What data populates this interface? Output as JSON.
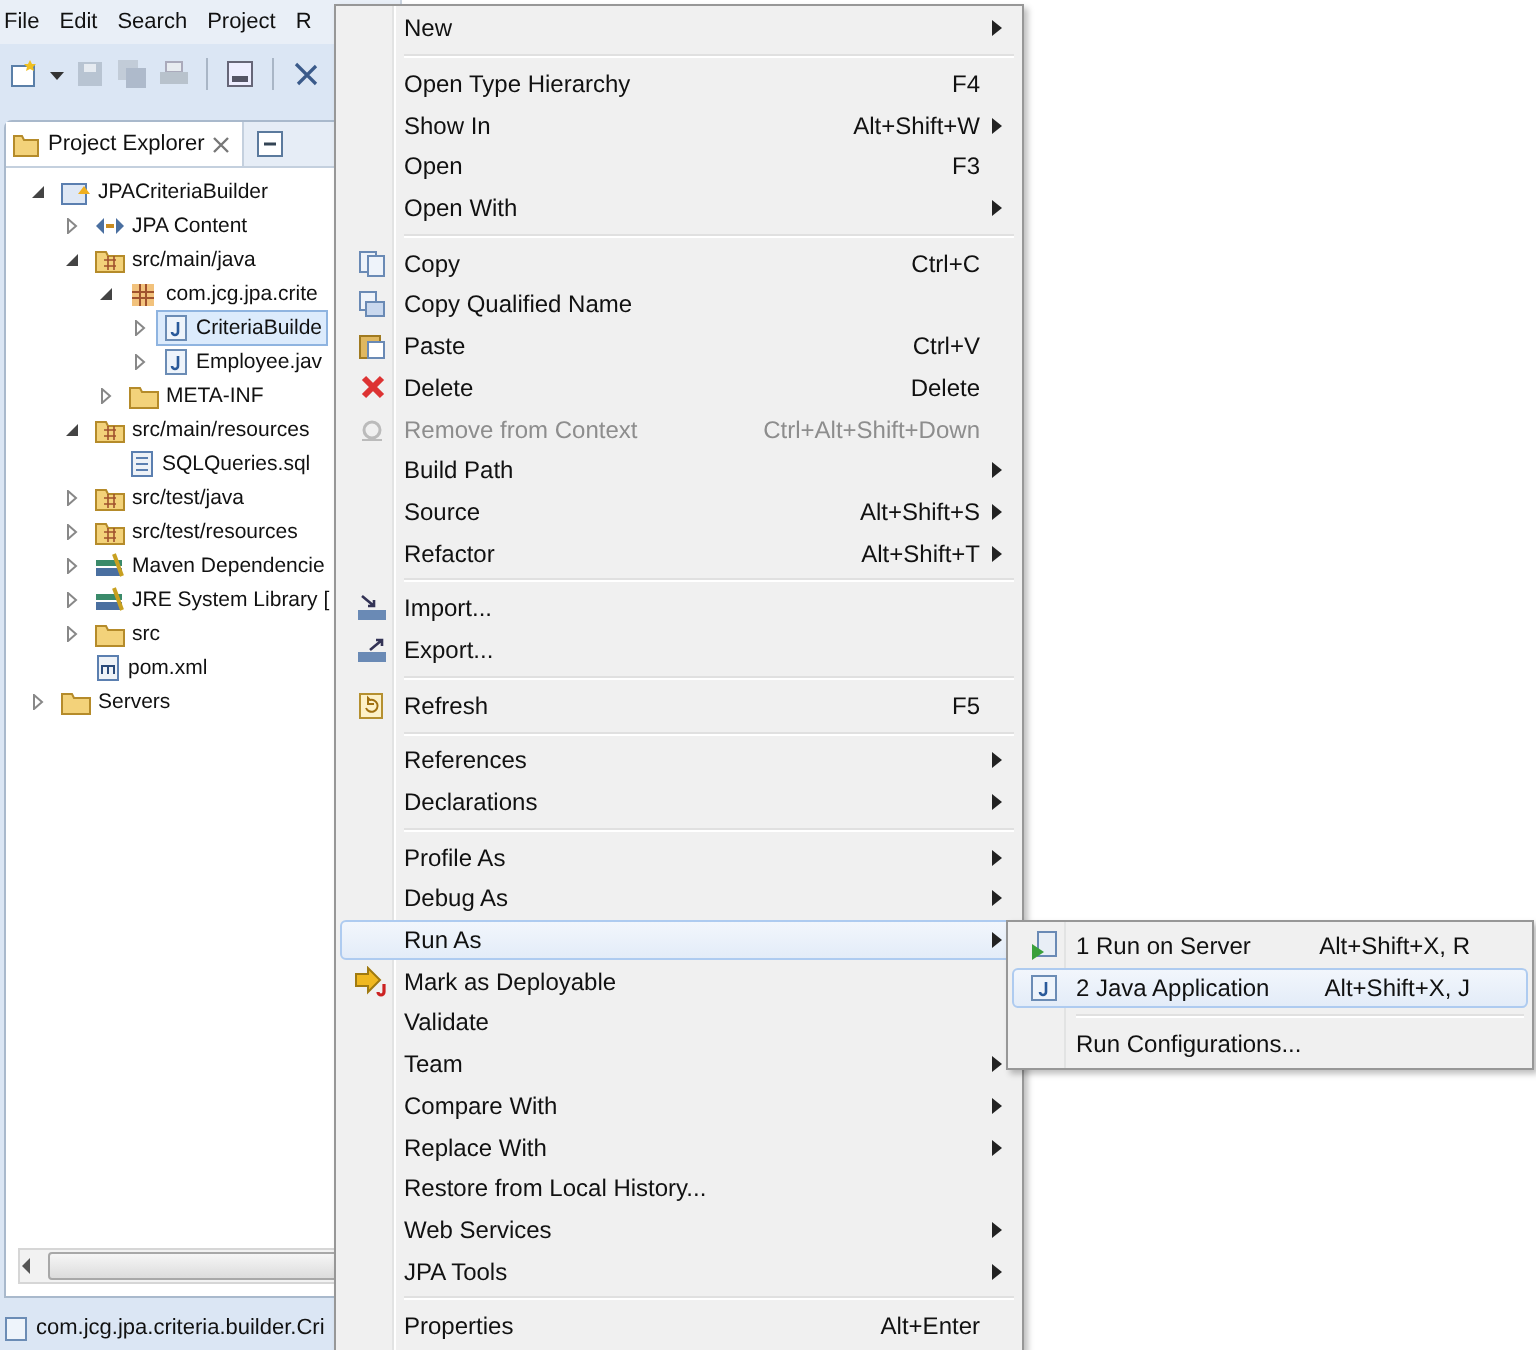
{
  "menubar": [
    "File",
    "Edit",
    "Search",
    "Project",
    "R"
  ],
  "explorer": {
    "title": "Project Explorer",
    "tree": [
      {
        "label": "JPACriteriaBuilder",
        "kind": "project",
        "expanded": true,
        "selected": false,
        "children": [
          {
            "label": "JPA Content",
            "kind": "jpa",
            "expanded": false,
            "selected": false
          },
          {
            "label": "src/main/java",
            "kind": "source-folder",
            "expanded": true,
            "selected": false,
            "children": [
              {
                "label": "com.jcg.jpa.crite",
                "kind": "package",
                "expanded": true,
                "selected": false,
                "children": [
                  {
                    "label": "CriteriaBuilde",
                    "kind": "java",
                    "expanded": false,
                    "selected": true
                  },
                  {
                    "label": "Employee.jav",
                    "kind": "java",
                    "expanded": false,
                    "selected": false
                  }
                ]
              },
              {
                "label": "META-INF",
                "kind": "folder",
                "expanded": false,
                "selected": false
              }
            ]
          },
          {
            "label": "src/main/resources",
            "kind": "source-folder",
            "expanded": true,
            "selected": false,
            "children": [
              {
                "label": "SQLQueries.sql",
                "kind": "sql",
                "selected": false
              }
            ]
          },
          {
            "label": "src/test/java",
            "kind": "source-folder",
            "expanded": false,
            "selected": false
          },
          {
            "label": "src/test/resources",
            "kind": "source-folder",
            "expanded": false,
            "selected": false
          },
          {
            "label": "Maven Dependencie",
            "kind": "library",
            "expanded": false,
            "selected": false
          },
          {
            "label": "JRE System Library [",
            "kind": "library",
            "expanded": false,
            "selected": false
          },
          {
            "label": "src",
            "kind": "folder",
            "expanded": false,
            "selected": false
          },
          {
            "label": "pom.xml",
            "kind": "xml",
            "selected": false
          }
        ]
      },
      {
        "label": "Servers",
        "kind": "folder",
        "expanded": false,
        "selected": false
      }
    ]
  },
  "status_bar": {
    "text": "com.jcg.jpa.criteria.builder.Cri"
  },
  "context_menu": [
    {
      "kind": "item",
      "label": "New",
      "submenu": true,
      "disabled": false,
      "selected": false
    },
    {
      "kind": "separator"
    },
    {
      "kind": "item",
      "label": "Open Type Hierarchy",
      "shortcut": "F4",
      "submenu": false,
      "disabled": false,
      "selected": false
    },
    {
      "kind": "item",
      "label": "Show In",
      "shortcut": "Alt+Shift+W",
      "submenu": true,
      "disabled": false,
      "selected": false
    },
    {
      "kind": "item",
      "label": "Open",
      "shortcut": "F3",
      "submenu": false,
      "disabled": false,
      "selected": false
    },
    {
      "kind": "item",
      "label": "Open With",
      "submenu": true,
      "disabled": false,
      "selected": false
    },
    {
      "kind": "separator"
    },
    {
      "kind": "copy",
      "label": "Copy",
      "shortcut": "Ctrl+C",
      "submenu": false,
      "disabled": false,
      "selected": false
    },
    {
      "kind": "copy-name",
      "label": "Copy Qualified Name",
      "submenu": false,
      "disabled": false,
      "selected": false
    },
    {
      "kind": "paste",
      "label": "Paste",
      "shortcut": "Ctrl+V",
      "submenu": false,
      "disabled": false,
      "selected": false
    },
    {
      "kind": "delete",
      "label": "Delete",
      "shortcut": "Delete",
      "submenu": false,
      "disabled": false,
      "selected": false
    },
    {
      "kind": "remove",
      "label": "Remove from Context",
      "shortcut": "Ctrl+Alt+Shift+Down",
      "submenu": false,
      "disabled": true,
      "selected": false
    },
    {
      "kind": "item",
      "label": "Build Path",
      "submenu": true,
      "disabled": false,
      "selected": false
    },
    {
      "kind": "item",
      "label": "Source",
      "shortcut": "Alt+Shift+S",
      "submenu": true,
      "disabled": false,
      "selected": false
    },
    {
      "kind": "item",
      "label": "Refactor",
      "shortcut": "Alt+Shift+T",
      "submenu": true,
      "disabled": false,
      "selected": false
    },
    {
      "kind": "separator"
    },
    {
      "kind": "import",
      "label": "Import...",
      "submenu": false,
      "disabled": false,
      "selected": false
    },
    {
      "kind": "export",
      "label": "Export...",
      "submenu": false,
      "disabled": false,
      "selected": false
    },
    {
      "kind": "separator"
    },
    {
      "kind": "refresh",
      "label": "Refresh",
      "shortcut": "F5",
      "submenu": false,
      "disabled": false,
      "selected": false
    },
    {
      "kind": "separator"
    },
    {
      "kind": "item",
      "label": "References",
      "submenu": true,
      "disabled": false,
      "selected": false
    },
    {
      "kind": "item",
      "label": "Declarations",
      "submenu": true,
      "disabled": false,
      "selected": false
    },
    {
      "kind": "separator"
    },
    {
      "kind": "item",
      "label": "Profile As",
      "submenu": true,
      "disabled": false,
      "selected": false
    },
    {
      "kind": "item",
      "label": "Debug As",
      "submenu": true,
      "disabled": false,
      "selected": false
    },
    {
      "kind": "item",
      "label": "Run As",
      "submenu": true,
      "disabled": false,
      "selected": true
    },
    {
      "kind": "deploy",
      "label": "Mark as Deployable",
      "submenu": false,
      "disabled": false,
      "selected": false
    },
    {
      "kind": "item",
      "label": "Validate",
      "submenu": false,
      "disabled": false,
      "selected": false
    },
    {
      "kind": "item",
      "label": "Team",
      "submenu": true,
      "disabled": false,
      "selected": false
    },
    {
      "kind": "item",
      "label": "Compare With",
      "submenu": true,
      "disabled": false,
      "selected": false
    },
    {
      "kind": "item",
      "label": "Replace With",
      "submenu": true,
      "disabled": false,
      "selected": false
    },
    {
      "kind": "item",
      "label": "Restore from Local History...",
      "submenu": false,
      "disabled": false,
      "selected": false
    },
    {
      "kind": "item",
      "label": "Web Services",
      "submenu": true,
      "disabled": false,
      "selected": false
    },
    {
      "kind": "item",
      "label": "JPA Tools",
      "submenu": true,
      "disabled": false,
      "selected": false
    },
    {
      "kind": "separator"
    },
    {
      "kind": "item",
      "label": "Properties",
      "shortcut": "Alt+Enter",
      "submenu": false,
      "disabled": false,
      "selected": false
    }
  ],
  "submenu": [
    {
      "kind": "server",
      "label": "1 Run on Server",
      "shortcut": "Alt+Shift+X, R",
      "selected": false
    },
    {
      "kind": "java",
      "label": "2 Java Application",
      "shortcut": "Alt+Shift+X, J",
      "selected": true
    },
    {
      "kind": "separator"
    },
    {
      "kind": "item",
      "label": "Run Configurations...",
      "selected": false
    }
  ]
}
